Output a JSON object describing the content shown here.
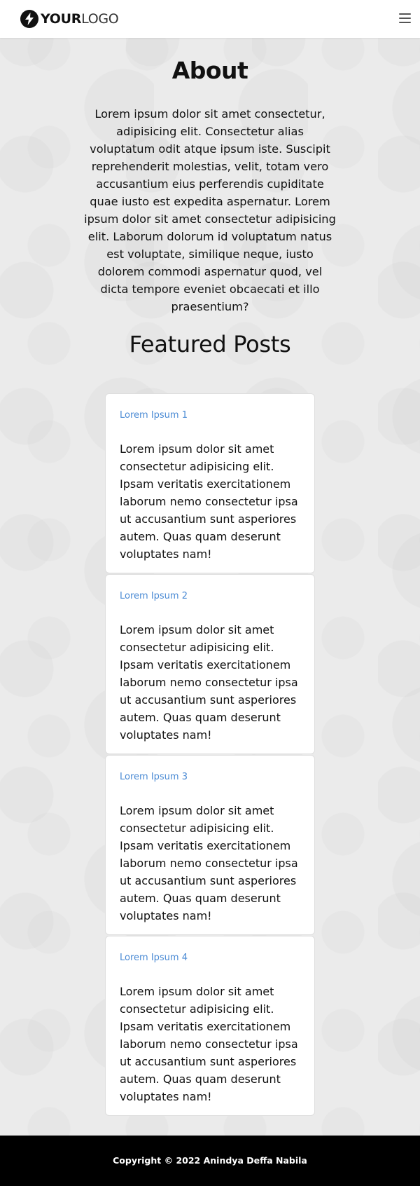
{
  "header": {
    "logo_bold": "YOUR",
    "logo_light": "LOGO",
    "logo_icon": "lightning-bolt-icon",
    "menu_icon": "hamburger-menu-icon"
  },
  "about": {
    "title": "About",
    "text": "Lorem ipsum dolor sit amet consectetur, adipisicing elit. Consectetur alias voluptatum odit atque ipsum iste. Suscipit reprehenderit molestias, velit, totam vero accusantium eius perferendis cupiditate quae iusto est expedita aspernatur. Lorem ipsum dolor sit amet consectetur adipisicing elit. Laborum dolorum id voluptatum natus est voluptate, similique neque, iusto dolorem commodi aspernatur quod, vel dicta tempore eveniet obcaecati et illo praesentium?"
  },
  "featured": {
    "title": "Featured Posts",
    "posts": [
      {
        "title": "Lorem Ipsum 1",
        "body": "Lorem ipsum dolor sit amet consectetur adipisicing elit. Ipsam veritatis exercitationem laborum nemo consectetur ipsa ut accusantium sunt asperiores autem. Quas quam deserunt voluptates nam!"
      },
      {
        "title": "Lorem Ipsum 2",
        "body": "Lorem ipsum dolor sit amet consectetur adipisicing elit. Ipsam veritatis exercitationem laborum nemo consectetur ipsa ut accusantium sunt asperiores autem. Quas quam deserunt voluptates nam!"
      },
      {
        "title": "Lorem Ipsum 3",
        "body": "Lorem ipsum dolor sit amet consectetur adipisicing elit. Ipsam veritatis exercitationem laborum nemo consectetur ipsa ut accusantium sunt asperiores autem. Quas quam deserunt voluptates nam!"
      },
      {
        "title": "Lorem Ipsum 4",
        "body": "Lorem ipsum dolor sit amet consectetur adipisicing elit. Ipsam veritatis exercitationem laborum nemo consectetur ipsa ut accusantium sunt asperiores autem. Quas quam deserunt voluptates nam!"
      }
    ]
  },
  "footer": {
    "copyright": "Copyright © 2022 Anindya Deffa Nabila"
  },
  "colors": {
    "background": "#ebebeb",
    "header": "#ffffff",
    "card_title": "#4a8ad4",
    "footer": "#000000"
  }
}
